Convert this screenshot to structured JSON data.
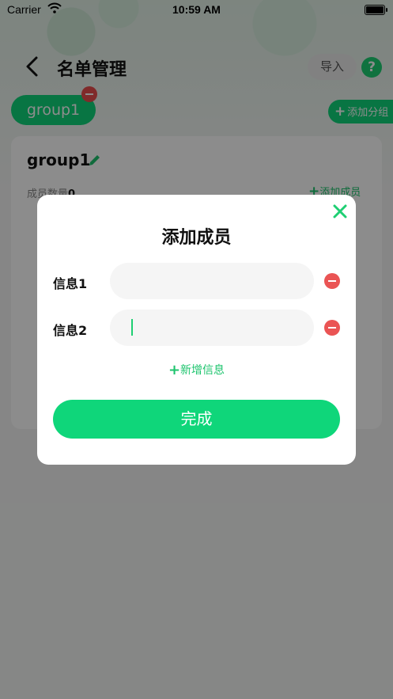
{
  "status_bar": {
    "carrier": "Carrier",
    "time": "10:59 AM"
  },
  "nav": {
    "title": "名单管理",
    "import_label": "导入",
    "help_label": "?"
  },
  "groups": {
    "chip_label": "group1",
    "add_group_label": "添加分组"
  },
  "card": {
    "title": "group1",
    "member_count_label": "成员数量",
    "member_count_value": "0",
    "add_member_label": "添加成员"
  },
  "modal": {
    "title": "添加成员",
    "fields": [
      {
        "label": "信息1",
        "value": ""
      },
      {
        "label": "信息2",
        "value": ""
      }
    ],
    "add_info_label": "新增信息",
    "done_label": "完成"
  },
  "colors": {
    "accent": "#0fd67a",
    "danger": "#ea5454"
  }
}
